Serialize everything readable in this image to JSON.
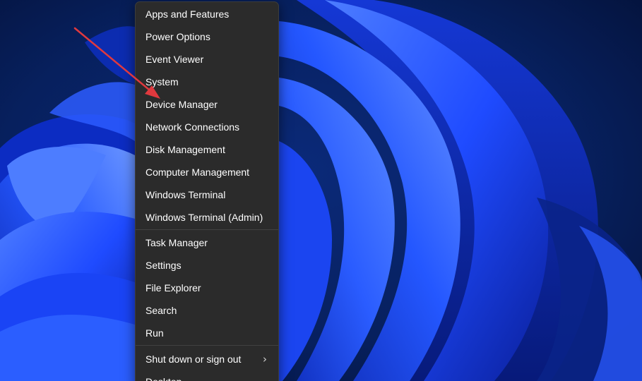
{
  "colors": {
    "menu_bg": "#2b2b2b",
    "menu_text": "#ffffff",
    "separator": "#414141",
    "annotation_arrow": "#e0393e",
    "wallpaper_dark": "#061a4a",
    "wallpaper_blue": "#1f4bff"
  },
  "context_menu": {
    "group_primary": [
      {
        "label": "Apps and Features",
        "name": "menu-item-apps-and-features"
      },
      {
        "label": "Power Options",
        "name": "menu-item-power-options"
      },
      {
        "label": "Event Viewer",
        "name": "menu-item-event-viewer"
      },
      {
        "label": "System",
        "name": "menu-item-system"
      },
      {
        "label": "Device Manager",
        "name": "menu-item-device-manager"
      },
      {
        "label": "Network Connections",
        "name": "menu-item-network-connections"
      },
      {
        "label": "Disk Management",
        "name": "menu-item-disk-management"
      },
      {
        "label": "Computer Management",
        "name": "menu-item-computer-management"
      },
      {
        "label": "Windows Terminal",
        "name": "menu-item-windows-terminal"
      },
      {
        "label": "Windows Terminal (Admin)",
        "name": "menu-item-windows-terminal-admin"
      }
    ],
    "group_tools": [
      {
        "label": "Task Manager",
        "name": "menu-item-task-manager"
      },
      {
        "label": "Settings",
        "name": "menu-item-settings"
      },
      {
        "label": "File Explorer",
        "name": "menu-item-file-explorer"
      },
      {
        "label": "Search",
        "name": "menu-item-search"
      },
      {
        "label": "Run",
        "name": "menu-item-run"
      }
    ],
    "group_power": [
      {
        "label": "Shut down or sign out",
        "name": "menu-item-shut-down-or-sign-out",
        "submenu": true,
        "submenu_icon": "chevron-right-icon"
      },
      {
        "label": "Desktop",
        "name": "menu-item-desktop"
      }
    ],
    "chevron_glyph": "›"
  },
  "annotation": {
    "icon": "red-arrow-pointing-to-device-manager"
  }
}
